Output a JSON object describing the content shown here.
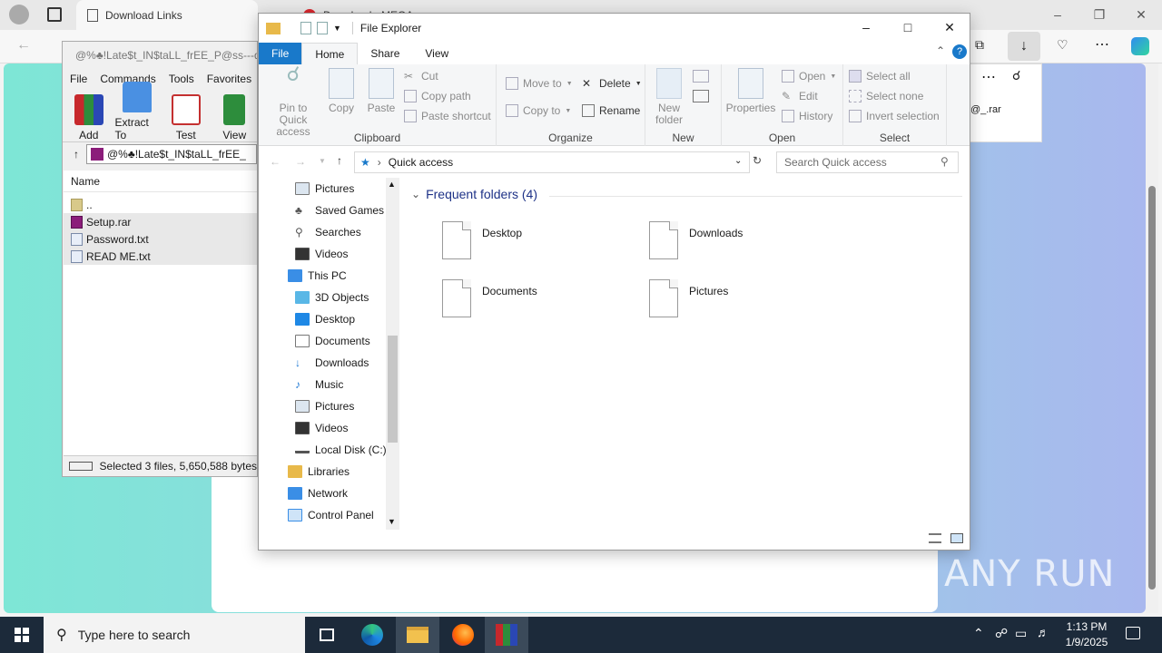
{
  "browser": {
    "tabs": [
      {
        "label": "Download Links"
      },
      {
        "label": "Download - MEGA"
      }
    ],
    "page_card_text": "@_.rar"
  },
  "winrar": {
    "title": "@%♣!Late$t_IN$taLL_frEE_P@ss---d",
    "menu": [
      "File",
      "Commands",
      "Tools",
      "Favorites"
    ],
    "tools": [
      "Add",
      "Extract To",
      "Test",
      "View"
    ],
    "address": "@%♣!Late$t_IN$taLL_frEE_",
    "column_name": "Name",
    "files": [
      "..",
      "Setup.rar",
      "Password.txt",
      "READ ME.txt"
    ],
    "status": "Selected 3 files, 5,650,588 bytes"
  },
  "explorer": {
    "title": "File Explorer",
    "ribbon_tabs": [
      "File",
      "Home",
      "Share",
      "View"
    ],
    "ribbon": {
      "pin": "Pin to Quick access",
      "copy": "Copy",
      "paste": "Paste",
      "cut": "Cut",
      "copy_path": "Copy path",
      "paste_shortcut": "Paste shortcut",
      "clipboard": "Clipboard",
      "move_to": "Move to",
      "copy_to": "Copy to",
      "delete": "Delete",
      "rename": "Rename",
      "organize": "Organize",
      "new_folder": "New folder",
      "new": "New",
      "properties": "Properties",
      "open": "Open",
      "edit": "Edit",
      "history": "History",
      "open_group": "Open",
      "select_all": "Select all",
      "select_none": "Select none",
      "invert_selection": "Invert selection",
      "select": "Select"
    },
    "address": "Quick access",
    "search_placeholder": "Search Quick access",
    "nav": {
      "items": [
        "Pictures",
        "Saved Games",
        "Searches",
        "Videos",
        "This PC",
        "3D Objects",
        "Desktop",
        "Documents",
        "Downloads",
        "Music",
        "Pictures",
        "Videos",
        "Local Disk (C:)",
        "Libraries",
        "Network",
        "Control Panel"
      ]
    },
    "frequent_header": "Frequent folders (4)",
    "folders": [
      "Desktop",
      "Downloads",
      "Documents",
      "Pictures"
    ]
  },
  "taskbar": {
    "search_placeholder": "Type here to search",
    "time": "1:13 PM",
    "date": "1/9/2025"
  },
  "watermark": "ANY RUN"
}
